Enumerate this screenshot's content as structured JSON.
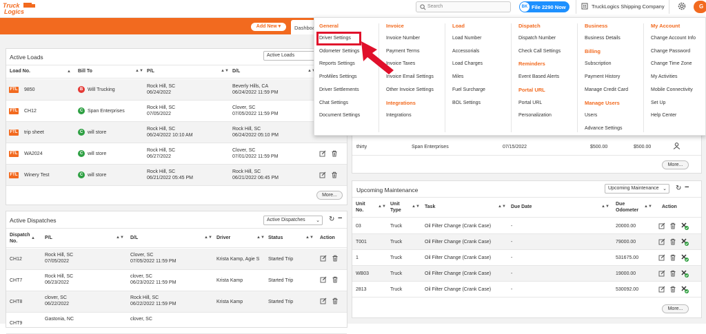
{
  "brand": {
    "logo_text": "Truck Logics",
    "brand_color": "#f26a1f",
    "accent_blue": "#1e90ff",
    "highlight_red": "#e0102b"
  },
  "header": {
    "search_placeholder": "Search",
    "file2290_badge": "BK",
    "file2290_label": "File 2290 Now",
    "company_name": "TruckLogics Shipping Company",
    "avatar_initial": "G"
  },
  "toolbar": {
    "add_new_label": "Add New ▾",
    "active_tab": "Dashboard"
  },
  "mega_menu": {
    "columns": [
      {
        "heading": "General",
        "items": [
          "Driver Settings",
          "Odometer Settings",
          "Reports Settings",
          "ProMiles Settings",
          "Driver Settlements",
          "Chat Settings",
          "Document Settings"
        ]
      },
      {
        "heading": "Invoice",
        "items": [
          "Invoice Number",
          "Payment Terms",
          "Invoice Taxes",
          "Invoice Email Settings",
          "Other Invoice Settings"
        ],
        "heading2": "Integrations",
        "items2": [
          "Integrations"
        ]
      },
      {
        "heading": "Load",
        "items": [
          "Load Number",
          "Accessorials",
          "Load Charges",
          "Miles",
          "Fuel Surcharge",
          "BOL Settings"
        ]
      },
      {
        "heading": "Dispatch",
        "items": [
          "Dispatch Number",
          "Check Call Settings"
        ],
        "heading2": "Reminders",
        "items2": [
          "Event Based Alerts"
        ],
        "heading3": "Portal URL",
        "items3": [
          "Portal URL",
          "Personalization"
        ]
      },
      {
        "heading": "Business",
        "items": [
          "Business Details"
        ],
        "heading2": "Billing",
        "items2": [
          "Subscription",
          "Payment History",
          "Manage Credit Card"
        ],
        "heading3": "Manage Users",
        "items3": [
          "Users",
          "Advance Settings"
        ]
      },
      {
        "heading": "My Account",
        "items": [
          "Change Account Info",
          "Change Password",
          "Change Time Zone",
          "My Activities",
          "Mobile Connectivity",
          "Set Up",
          "Help Center"
        ]
      }
    ]
  },
  "active_loads": {
    "title": "Active Loads",
    "filter": "Active Loads",
    "columns": [
      "Load No.",
      "Bill To",
      "P/L",
      "D/L"
    ],
    "rows": [
      {
        "tag": "FTL",
        "load": "9850",
        "bill_initial": "B",
        "bill_to": "Will Trucking",
        "pl_city": "Rock Hill, SC",
        "pl_date": "06/24/2022",
        "dl_city": "Beverly Hills, CA",
        "dl_date": "06/24/2022 11:59 PM"
      },
      {
        "tag": "FTL",
        "load": "CH12",
        "bill_initial": "C",
        "bill_to": "Span Enterprises",
        "pl_city": "Rock Hill, SC",
        "pl_date": "07/05/2022",
        "dl_city": "Clover, SC",
        "dl_date": "07/05/2022 11:59 PM"
      },
      {
        "tag": "FTL",
        "load": "trip sheet",
        "bill_initial": "C",
        "bill_to": "will store",
        "pl_city": "Rock Hill, SC",
        "pl_date": "06/24/2022 10:10 AM",
        "dl_city": "Rock Hill, SC",
        "dl_date": "06/24/2022 05:10 PM"
      },
      {
        "tag": "FTL",
        "load": "WA2024",
        "bill_initial": "C",
        "bill_to": "will store",
        "pl_city": "Rock Hill, SC",
        "pl_date": "06/27/2022",
        "dl_city": "Clover, SC",
        "dl_date": "07/01/2022 11:59 PM"
      },
      {
        "tag": "FTL",
        "load": "Winery Test",
        "bill_initial": "C",
        "bill_to": "will store",
        "pl_city": "Rock Hill, SC",
        "pl_date": "06/21/2022 05:45 PM",
        "dl_city": "Rock Hill, SC",
        "dl_date": "06/21/2022 06:45 PM"
      }
    ],
    "more": "More..."
  },
  "active_dispatches": {
    "title": "Active Dispatches",
    "filter": "Active Dispatches",
    "columns": [
      "Dispatch No.",
      "P/L",
      "D/L",
      "Driver",
      "Status",
      "Action"
    ],
    "rows": [
      {
        "no": "CH12",
        "pl_city": "Rock Hill, SC",
        "pl_date": "07/05/2022",
        "dl_city": "Clover, SC",
        "dl_date": "07/05/2022 11:59 PM",
        "driver": "Krista Kamp, Agie S",
        "status": "Started Trip"
      },
      {
        "no": "CHT7",
        "pl_city": "Rock Hill, SC",
        "pl_date": "06/23/2022",
        "dl_city": "clover, SC",
        "dl_date": "06/23/2022 11:59 PM",
        "driver": "Krista Kamp",
        "status": "Started Trip"
      },
      {
        "no": "CHT8",
        "pl_city": "clover, SC",
        "pl_date": "06/22/2022",
        "dl_city": "Rock Hill, SC",
        "dl_date": "06/22/2022 11:59 PM",
        "driver": "Krista Kamp",
        "status": "Started Trip"
      },
      {
        "no": "CHT9",
        "pl_city": "Gastonia, NC",
        "pl_date": "",
        "dl_city": "clover, SC",
        "dl_date": "",
        "driver": "",
        "status": ""
      }
    ]
  },
  "partial_row": {
    "name": "thirty",
    "customer": "Span Enterprises",
    "date": "07/15/2022",
    "amount1": "$500.00",
    "amount2": "$500.00",
    "more": "More..."
  },
  "upcoming_maintenance": {
    "title": "Upcoming Maintenance",
    "filter": "Upcoming Maintenance",
    "columns": [
      "Unit No.",
      "Unit Type",
      "Task",
      "Due Date",
      "Due Odometer",
      "Action"
    ],
    "rows": [
      {
        "unit": "03",
        "type": "Truck",
        "task": "Oil Filter Change (Crank Case)",
        "due": "-",
        "odo": "20000.00"
      },
      {
        "unit": "T001",
        "type": "Truck",
        "task": "Oil Filter Change (Crank Case)",
        "due": "-",
        "odo": "79000.00"
      },
      {
        "unit": "1",
        "type": "Truck",
        "task": "Oil Filter Change (Crank Case)",
        "due": "-",
        "odo": "531675.00"
      },
      {
        "unit": "WB03",
        "type": "Truck",
        "task": "Oil Filter Change (Crank Case)",
        "due": "-",
        "odo": "19000.00"
      },
      {
        "unit": "2813",
        "type": "Truck",
        "task": "Oil Filter Change (Crank Case)",
        "due": "-",
        "odo": "530092.00"
      }
    ],
    "more": "More..."
  }
}
